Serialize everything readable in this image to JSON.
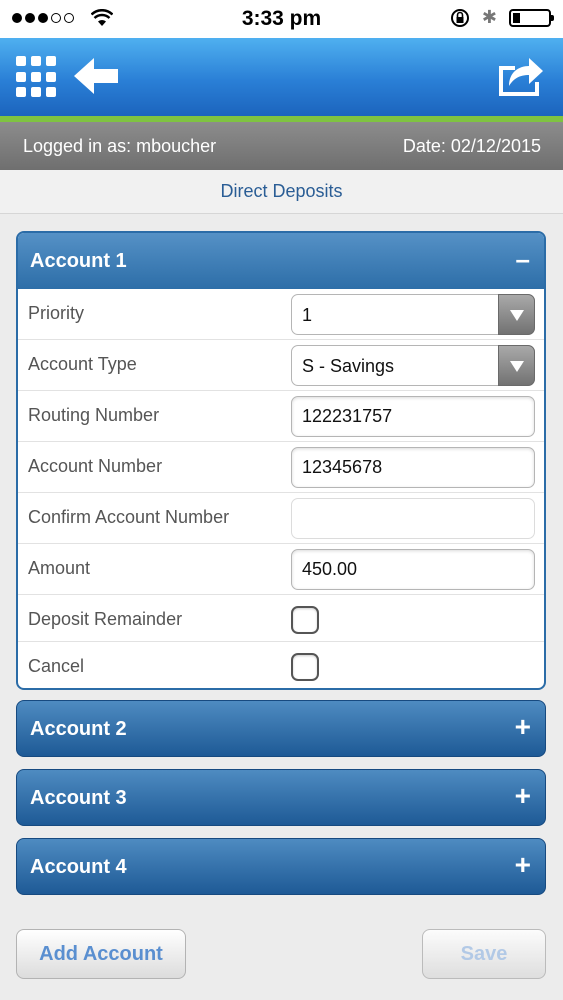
{
  "status_bar": {
    "time": "3:33 pm",
    "signal_bars": 3,
    "signal_total": 5,
    "battery_level": 0.2
  },
  "nav": {
    "menu_icon": "grid-icon",
    "back_icon": "arrow-left-icon",
    "share_icon": "share-icon"
  },
  "info": {
    "logged_in": "Logged in as: mboucher",
    "date": "Date: 02/12/2015"
  },
  "page_title": "Direct Deposits",
  "account1": {
    "title": "Account 1",
    "toggle": "–",
    "fields": {
      "priority_label": "Priority",
      "priority_value": "1",
      "account_type_label": "Account Type",
      "account_type_value": "S - Savings",
      "routing_label": "Routing Number",
      "routing_value": "122231757",
      "account_number_label": "Account Number",
      "account_number_value": "12345678",
      "confirm_label": "Confirm Account Number",
      "confirm_value": "",
      "amount_label": "Amount",
      "amount_value": "450.00",
      "deposit_remainder_label": "Deposit Remainder",
      "deposit_remainder_checked": false,
      "cancel_label": "Cancel",
      "cancel_checked": false
    }
  },
  "collapsed_accounts": [
    {
      "title": "Account 2",
      "toggle": "+"
    },
    {
      "title": "Account 3",
      "toggle": "+"
    },
    {
      "title": "Account 4",
      "toggle": "+"
    }
  ],
  "buttons": {
    "add_account": "Add Account",
    "save": "Save"
  },
  "colors": {
    "nav_blue": "#2a7fd6",
    "accent_green": "#7fc341",
    "panel_blue": "#2d6ea8",
    "title_blue": "#2a5d95"
  }
}
